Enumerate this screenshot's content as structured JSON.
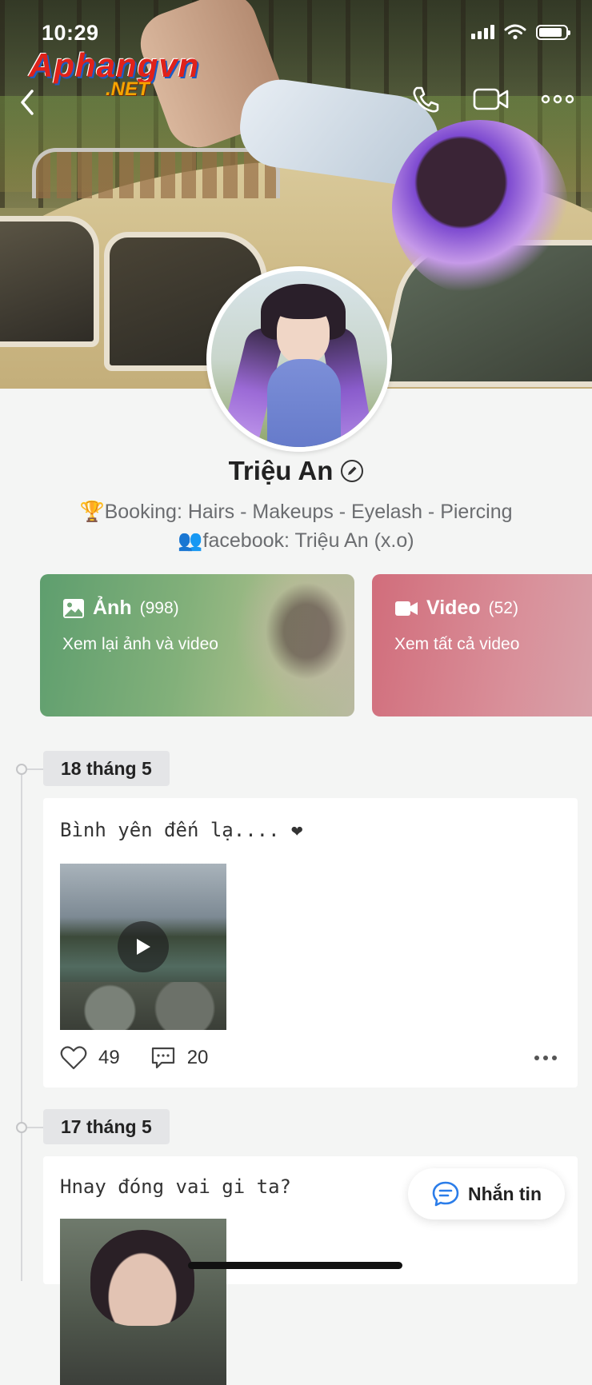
{
  "status_bar": {
    "time": "10:29"
  },
  "watermark": {
    "main": "Aphangvn",
    "sub": ".NET"
  },
  "profile": {
    "name": "Triệu An",
    "bio_line_1": "🏆Booking: Hairs - Makeups - Eyelash - Piercing",
    "bio_line_2": "👥facebook: Triệu An (x.o)"
  },
  "media_cards": [
    {
      "title": "Ảnh",
      "count": "(998)",
      "subtitle": "Xem lại ảnh và video",
      "icon": "image-icon"
    },
    {
      "title": "Video",
      "count": "(52)",
      "subtitle": "Xem tất cả video",
      "icon": "video-camera-icon"
    }
  ],
  "timeline": [
    {
      "date": "18 tháng 5",
      "text": "Bình yên đến lạ.... ❤",
      "likes": "49",
      "comments": "20",
      "media": "video"
    },
    {
      "date": "17 tháng 5",
      "text": "Hnay đóng vai gi ta?",
      "media": "photo"
    }
  ],
  "message_button": {
    "label": "Nhắn tin",
    "icon": "chat-bubble-icon"
  },
  "colors": {
    "photo_card": "#6fa676",
    "video_card": "#d47a86",
    "background": "#f4f5f4"
  }
}
